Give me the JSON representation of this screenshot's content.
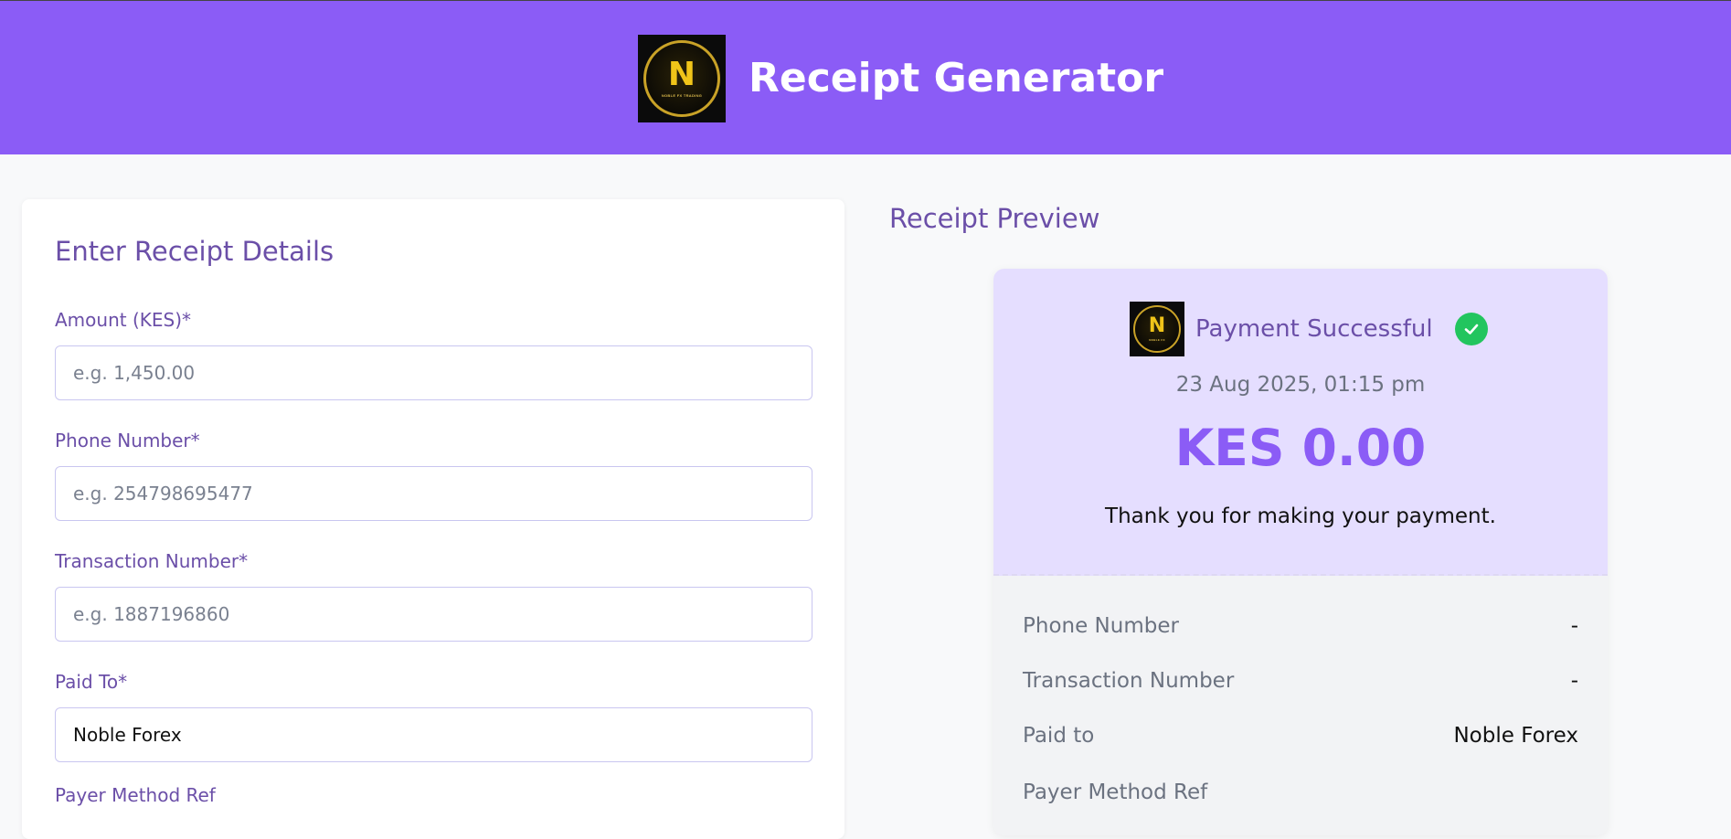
{
  "header": {
    "title": "Receipt Generator",
    "logo_icon": "noble-forex-logo"
  },
  "form": {
    "title": "Enter Receipt Details",
    "fields": [
      {
        "label": "Amount (KES)*",
        "placeholder": "e.g. 1,450.00",
        "value": ""
      },
      {
        "label": "Phone Number*",
        "placeholder": "e.g. 254798695477",
        "value": ""
      },
      {
        "label": "Transaction Number*",
        "placeholder": "e.g. 1887196860",
        "value": ""
      },
      {
        "label": "Paid To*",
        "placeholder": "",
        "value": "Noble Forex"
      }
    ],
    "next_label_partial": "Payer Method Ref"
  },
  "preview": {
    "title": "Receipt Preview",
    "status": "Payment Successful",
    "date": "23 Aug 2025, 01:15 pm",
    "amount": "KES 0.00",
    "thanks": "Thank you for making your payment.",
    "rows": [
      {
        "key": "Phone Number",
        "value": "-"
      },
      {
        "key": "Transaction Number",
        "value": "-"
      },
      {
        "key": "Paid to",
        "value": "Noble Forex"
      },
      {
        "key": "Payer Method Ref",
        "value": ""
      }
    ]
  },
  "colors": {
    "accent": "#8b5cf6",
    "label": "#6b4fa8",
    "success": "#22c55e",
    "receipt_bg": "#e5deff"
  }
}
